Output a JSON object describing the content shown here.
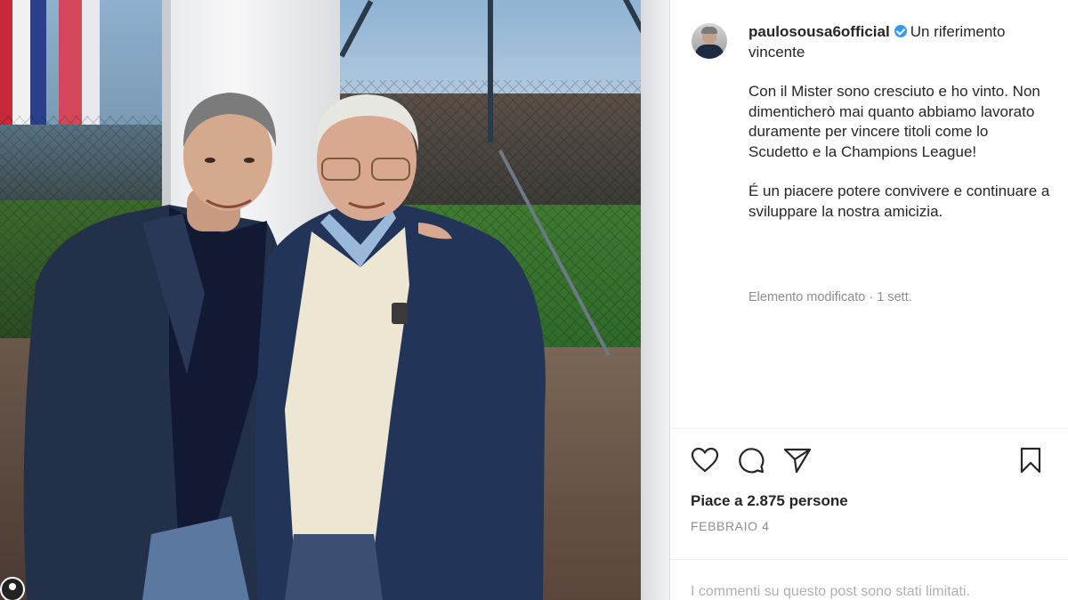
{
  "post": {
    "username": "paulosousa6official",
    "verified_icon": "verified-badge-icon",
    "caption_title": "Un riferimento vincente",
    "paragraph_1": "Con il Mister sono cresciuto e ho vinto. Non dimenticherò mai quanto abbiamo lavorato duramente per vincere titoli come lo Scudetto e la Champions League!",
    "paragraph_2": "É un piacere potere convivere e continuare a sviluppare la nostra amicizia.",
    "meta": "Elemento modificato · 1 sett.",
    "likes": "Piace a 2.875 persone",
    "date": "FEBBRAIO 4",
    "comments_limited": "I commenti su questo post sono stati limitati."
  },
  "icons": {
    "like": "heart-icon",
    "comment": "comment-bubble-icon",
    "share": "paper-plane-icon",
    "save": "bookmark-icon"
  },
  "colors": {
    "text": "#262626",
    "secondary": "#8e8e8e",
    "verified": "#3897f0",
    "divider": "#efefef"
  }
}
